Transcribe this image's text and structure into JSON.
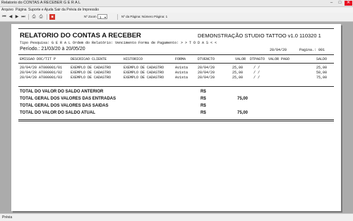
{
  "window": {
    "title": "Relatorio do CONTAS A RECEBER G E R A L"
  },
  "menu": [
    "Arquivo",
    "Página",
    "Suporte e Ajuda",
    "Sair da Prévia de Impressão"
  ],
  "toolbar": {
    "nav_icons": [
      "first-page-icon",
      "prev-page-icon",
      "next-page-icon",
      "last-page-icon"
    ],
    "zoom_label": "Nº Zoom",
    "zoom_value": "1",
    "page_label": "Nº da Página: Número Página: 1"
  },
  "report": {
    "title": "RELATORIO DO CONTAS A RECEBER",
    "company": "DEMONSTRAÇÃO STUDIO TATTOO v1.0 110320 1",
    "filters": "Tipo Pesquisa: G E R A L    Ordem do Relatório: Vencimento  Forma de Pagamento: > > T O D A S < <",
    "period": "Período.: 21/03/20 à 20/05/20",
    "print_date": "20/04/20",
    "page_label": "Pagina.: 001",
    "columns": {
      "emissao": "EMISSAO DOC/TIT P",
      "descricao": "DESCRICAO CLIENTE",
      "historico": "HISTORICO",
      "forma": "FORMA",
      "dtvencto": "DTVENCTO",
      "valor": "VALOR",
      "dtpagto": "DTPAGTO",
      "valor_pago": "VALOR PAGO",
      "saldo": "SALDO"
    },
    "rows": [
      {
        "emissao": "20/04/20 AT000001/01",
        "cliente": "EXEMPLO DE CADASTRO",
        "historico": "EXEMPLO DE CADASTRO",
        "forma": "Avista",
        "dtvencto": "20/04/20",
        "valor": "25,00",
        "dtpagto": "/  /",
        "saldo": "25,00"
      },
      {
        "emissao": "20/04/20 AT000001/02",
        "cliente": "EXEMPLO DE CADASTRO",
        "historico": "EXEMPLO DE CADASTRO",
        "forma": "Avista",
        "dtvencto": "20/04/20",
        "valor": "25,00",
        "dtpagto": "/  /",
        "saldo": "50,00"
      },
      {
        "emissao": "20/04/20 AT000001/03",
        "cliente": "EXEMPLO DE CADASTRO",
        "historico": "EXEMPLO DE CADASTRO",
        "forma": "Avista",
        "dtvencto": "20/04/20",
        "valor": "25,00",
        "dtpagto": "/  /",
        "saldo": "75,00"
      }
    ],
    "totals": [
      {
        "label": "TOTAL DO VALOR DO SALDO ANTERIOR",
        "currency": "R$",
        "value": ""
      },
      {
        "label": "TOTAL GERAL DOS VALORES DAS ENTRADAS",
        "currency": "R$",
        "value": "75,00"
      },
      {
        "label": "TOTAL GERAL DOS VALORES DAS SAIDAS",
        "currency": "R$",
        "value": ""
      },
      {
        "label": "TOTAL DO VALOR DO SALDO ATUAL",
        "currency": "R$",
        "value": "75,00"
      }
    ]
  },
  "status": {
    "text": "Prévia"
  }
}
